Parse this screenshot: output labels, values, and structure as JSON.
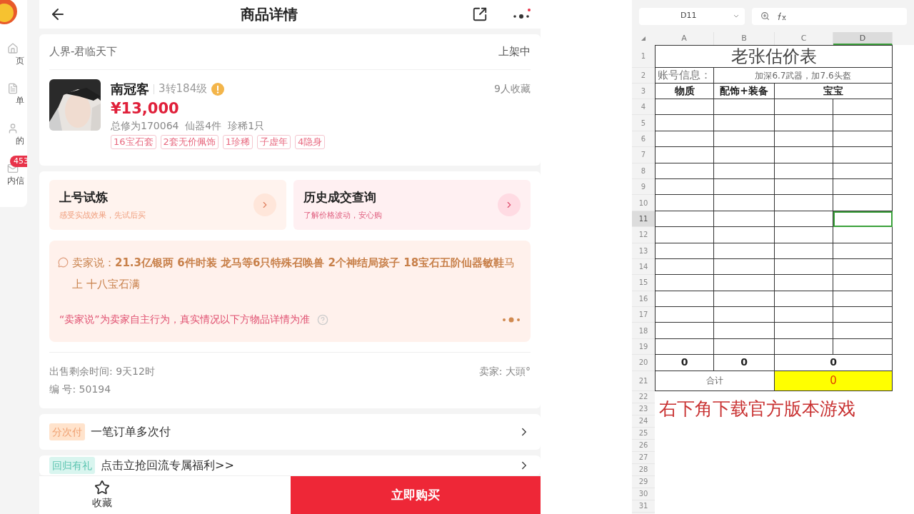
{
  "sidebar": {
    "items": [
      {
        "label": "页",
        "kind": "home"
      },
      {
        "label": "单",
        "kind": "orders"
      },
      {
        "label": "的",
        "kind": "profile"
      },
      {
        "label": "内信",
        "kind": "mail",
        "badge": "453"
      }
    ]
  },
  "header": {
    "title": "商品详情"
  },
  "listing": {
    "server": "人界-君临天下",
    "status": "上架中",
    "name": "南冠客",
    "level": "3转184级",
    "favorites": "9人收藏",
    "price": "¥13,000",
    "stats": "总修为170064  仙器4件  珍稀1只",
    "tags": [
      "16宝石套",
      "2套无价佩饰",
      "1珍稀",
      "子虚年",
      "4隐身"
    ]
  },
  "promos": [
    {
      "title": "上号试炼",
      "subtitle": "感受实战效果，先试后买",
      "kind": "orange"
    },
    {
      "title": "历史成交查询",
      "subtitle": "了解价格波动，安心购",
      "kind": "pink"
    }
  ],
  "seller_says": {
    "text": "卖家说：**21.3亿银两 6件时装 龙马等6只特殊召唤兽 2个神结局孩子 18宝石五阶仙器敏鞋**马上 十八宝石满",
    "disclaimer": "“卖家说”为卖家自主行为，真实情况以下方物品详情为准"
  },
  "sale_info": {
    "remaining": "出售剩余时间: 9天12时",
    "seller": "卖家: 大頭°",
    "number": "编 号: 50194"
  },
  "offers": [
    {
      "badge": "分次付",
      "text": "一笔订单多次付",
      "kind": "orange"
    },
    {
      "badge": "回归有礼",
      "text": "点击立抢回流专属福利>>",
      "kind": "teal"
    }
  ],
  "bottom_bar": {
    "favorite": "收藏",
    "buy": "立即购买"
  },
  "sheet": {
    "name_box": "D11",
    "columns": [
      {
        "label": "A",
        "selected": false
      },
      {
        "label": "B",
        "selected": false
      },
      {
        "label": "C",
        "selected": false
      },
      {
        "label": "D",
        "selected": true
      }
    ],
    "rows": [
      {
        "label": "1",
        "selected": false
      },
      {
        "label": "2",
        "selected": false
      },
      {
        "label": "3",
        "selected": false
      },
      {
        "label": "4",
        "selected": false
      },
      {
        "label": "5",
        "selected": false
      },
      {
        "label": "6",
        "selected": false
      },
      {
        "label": "7",
        "selected": false
      },
      {
        "label": "8",
        "selected": false
      },
      {
        "label": "9",
        "selected": false
      },
      {
        "label": "10",
        "selected": false
      },
      {
        "label": "11",
        "selected": true
      },
      {
        "label": "12",
        "selected": false
      },
      {
        "label": "13",
        "selected": false
      },
      {
        "label": "14",
        "selected": false
      },
      {
        "label": "15",
        "selected": false
      },
      {
        "label": "16",
        "selected": false
      },
      {
        "label": "17",
        "selected": false
      },
      {
        "label": "18",
        "selected": false
      },
      {
        "label": "19",
        "selected": false
      },
      {
        "label": "20",
        "selected": false
      },
      {
        "label": "21",
        "selected": false
      },
      {
        "label": "22",
        "selected": false
      },
      {
        "label": "23",
        "selected": false
      },
      {
        "label": "24",
        "selected": false
      },
      {
        "label": "25",
        "selected": false
      },
      {
        "label": "26",
        "selected": false
      },
      {
        "label": "27",
        "selected": false
      },
      {
        "label": "28",
        "selected": false
      },
      {
        "label": "29",
        "selected": false
      },
      {
        "label": "30",
        "selected": false
      },
      {
        "label": "31",
        "selected": false
      }
    ],
    "title": "老张估价表",
    "account_label": "账号信息：",
    "account_info": "加深6.7武器，加7.6头盔",
    "headers": [
      "物质",
      "配饰+装备",
      "宝宝"
    ],
    "totals": [
      "0",
      "0",
      "0"
    ],
    "sum_label": "合计",
    "sum_value": "0",
    "note": "右下角下载官方版本游戏"
  }
}
